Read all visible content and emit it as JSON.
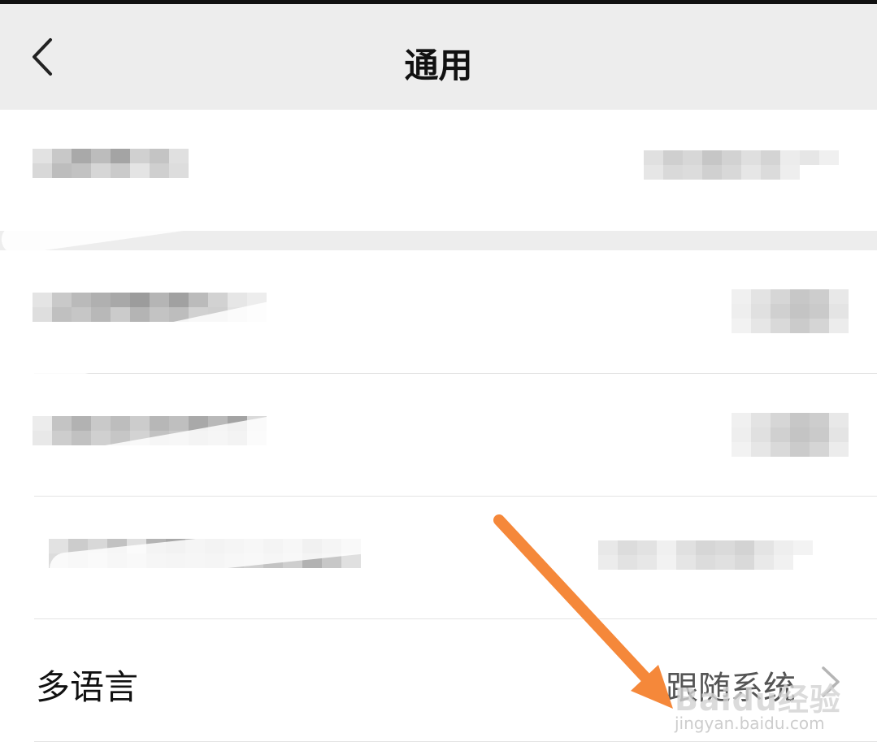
{
  "header": {
    "title": "通用"
  },
  "language_row": {
    "label": "多语言",
    "value": "跟随系统"
  },
  "watermark": {
    "brand": "Baidu经验",
    "url": "jingyan.baidu.com"
  },
  "annotation": {
    "arrow_color": "#f5883a"
  },
  "icons": {
    "back": "chevron-left-icon",
    "row_chevron": "chevron-right-icon"
  },
  "colors": {
    "nav_bg": "#ededed",
    "page_bg": "#ffffff",
    "divider": "#e3e3e3"
  }
}
